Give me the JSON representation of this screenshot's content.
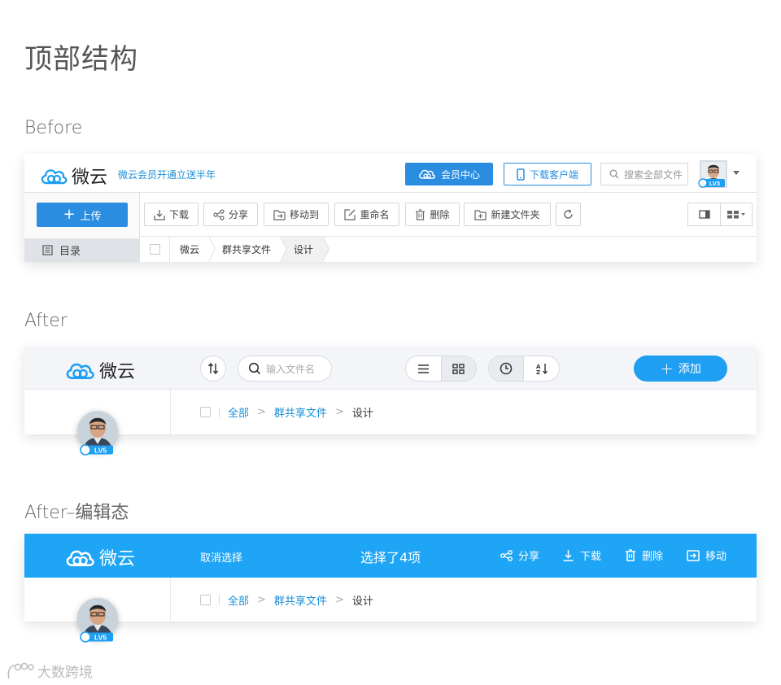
{
  "page_title": "顶部结构",
  "sections": {
    "before": "Before",
    "after": "After",
    "after_edit": "After–编辑态"
  },
  "colors": {
    "primary": "#2b8de0",
    "accent": "#1e9ff2",
    "edit_bar": "#1ea5f5",
    "link": "#1a8fd8"
  },
  "before": {
    "logo": "微云",
    "promo": "微云会员开通立送半年",
    "vip_label": "会员中心",
    "client_label": "下载客户端",
    "search_placeholder": "搜索全部文件",
    "avatar_badge": "LV3",
    "upload_label": "上传",
    "sidebar_dir": "目录",
    "toolbar": [
      "下载",
      "分享",
      "移动到",
      "重命名",
      "删除",
      "新建文件夹"
    ],
    "toolbar_icons": [
      "download-icon",
      "share-icon",
      "move-icon",
      "rename-icon",
      "delete-icon",
      "new-folder-icon",
      "refresh-icon"
    ],
    "breadcrumb": [
      "微云",
      "群共享文件",
      "设计"
    ]
  },
  "after": {
    "logo": "微云",
    "search_placeholder": "输入文件名",
    "add_label": "添加",
    "avatar_badge": "LV5",
    "breadcrumb": [
      "全部",
      "群共享文件",
      "设计"
    ]
  },
  "after_edit": {
    "logo": "微云",
    "cancel_label": "取消选择",
    "selected_label": "选择了4项",
    "actions": [
      "分享",
      "下载",
      "删除",
      "移动"
    ],
    "avatar_badge": "LV5",
    "breadcrumb": [
      "全部",
      "群共享文件",
      "设计"
    ]
  },
  "watermark": "大数跨境"
}
